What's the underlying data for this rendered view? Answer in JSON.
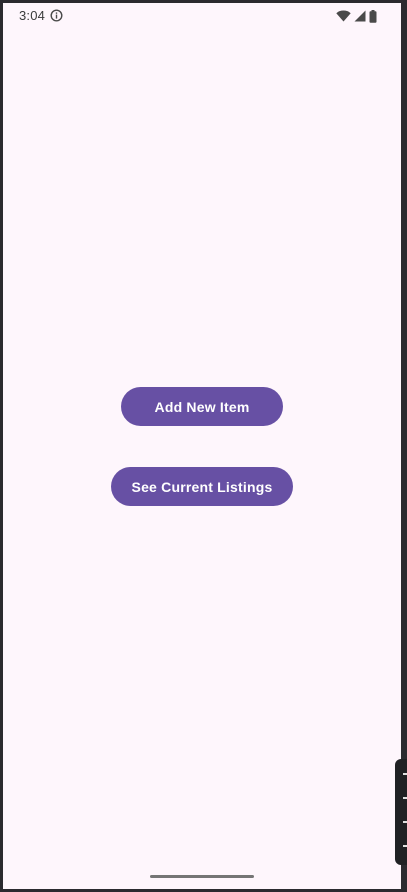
{
  "status_bar": {
    "time": "3:04",
    "info_icon": "info-circle-icon",
    "wifi_icon": "wifi-icon",
    "signal_icon": "cell-signal-icon",
    "battery_icon": "battery-icon"
  },
  "main": {
    "add_button_label": "Add New Item",
    "listings_button_label": "See Current Listings"
  },
  "colors": {
    "background": "#fef6fc",
    "button": "#6750a4",
    "button_text": "#ffffff",
    "frame": "#2b2a2f"
  }
}
